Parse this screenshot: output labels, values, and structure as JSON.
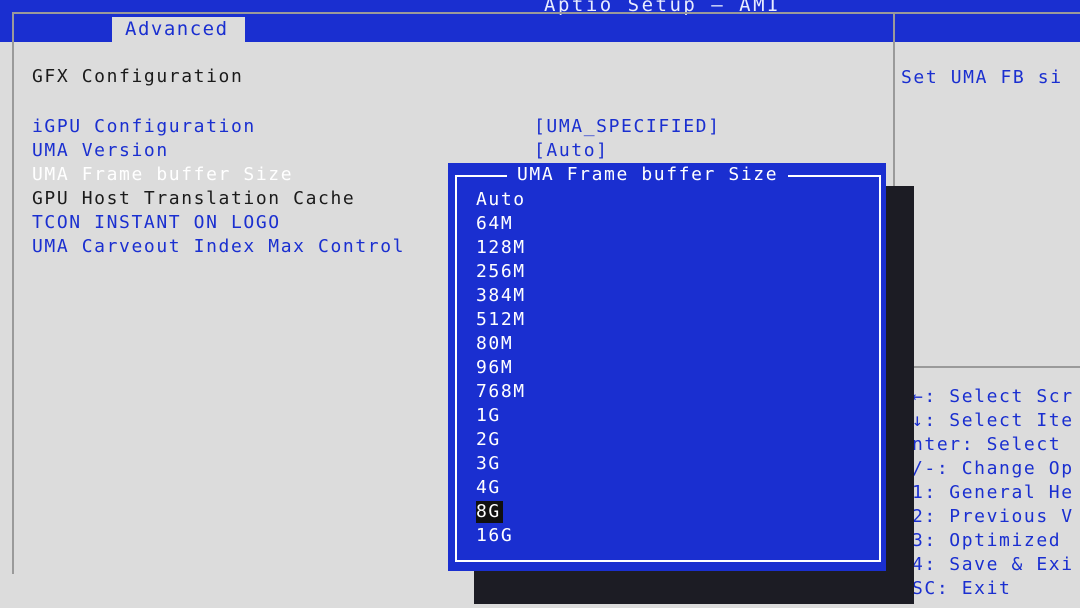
{
  "header": {
    "title": "Aptio Setup – AMI",
    "active_tab": "Advanced"
  },
  "colors": {
    "header_bg": "#1a2fd0",
    "panel_bg": "#dcdcdc",
    "popup_bg": "#1a2fd0",
    "link_text": "#1a2fd0"
  },
  "main": {
    "section_title": "GFX Configuration",
    "items": [
      {
        "label": "iGPU Configuration",
        "value": "[UMA_SPECIFIED]",
        "style": "blue"
      },
      {
        "label": "UMA Version",
        "value": "[Auto]",
        "style": "blue"
      },
      {
        "label": "UMA Frame buffer Size",
        "value": "",
        "style": "highlighted"
      },
      {
        "label": "GPU Host Translation Cache",
        "value": "",
        "style": "black"
      },
      {
        "label": "TCON INSTANT ON LOGO",
        "value": "",
        "style": "blue"
      },
      {
        "label": "UMA Carveout Index Max Control",
        "value": "",
        "style": "blue"
      }
    ]
  },
  "help": {
    "text": "Set UMA FB si",
    "keys": [
      "←: Select Scr",
      "↓: Select Ite",
      "nter: Select",
      "/-: Change Op",
      "1: General He",
      "2: Previous V",
      "3: Optimized",
      "4: Save & Exi",
      "SC: Exit"
    ]
  },
  "popup": {
    "title": "UMA Frame buffer Size",
    "options": [
      "Auto",
      "64M",
      "128M",
      "256M",
      "384M",
      "512M",
      "80M",
      "96M",
      "768M",
      "1G",
      "2G",
      "3G",
      "4G",
      "8G",
      "16G"
    ],
    "selected": "8G"
  }
}
